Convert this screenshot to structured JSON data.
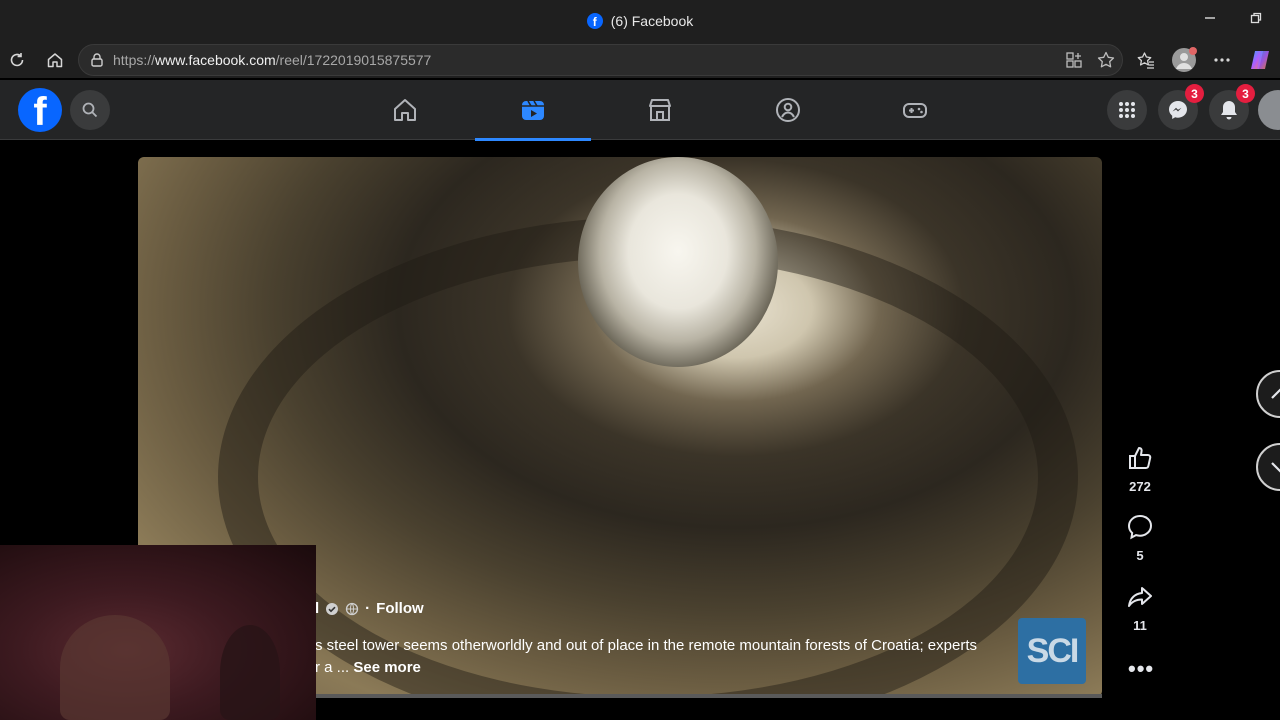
{
  "window": {
    "title": "(6) Facebook",
    "favicon_letter": "f"
  },
  "browser": {
    "url_prefix": "https://",
    "url_host": "www.facebook.com",
    "url_path": "/reel/1722019015875577",
    "icons": [
      "refresh-icon",
      "home-icon",
      "site-info-icon",
      "app-available-icon",
      "favorite-star-icon",
      "favorites-icon",
      "profile-icon",
      "more-icon",
      "copilot-icon"
    ]
  },
  "facebook": {
    "logo_letter": "f",
    "tabs": [
      {
        "name": "home",
        "active": false
      },
      {
        "name": "video",
        "active": true
      },
      {
        "name": "marketplace",
        "active": false
      },
      {
        "name": "groups",
        "active": false
      },
      {
        "name": "gaming",
        "active": false
      }
    ],
    "messenger_badge": "3",
    "notifications_badge": "3",
    "accent_color": "#2d88ff",
    "badge_color": "#e41e3f"
  },
  "reel": {
    "author_suffix": "l",
    "follow_label": "Follow",
    "caption_line1": "s steel tower seems otherworldly and out of place in the remote mountain forests of Croatia; experts",
    "caption_line2": "r a ...",
    "see_more": "See more",
    "channel_logo": "SCI",
    "likes": "272",
    "comments": "5",
    "shares": "11"
  }
}
